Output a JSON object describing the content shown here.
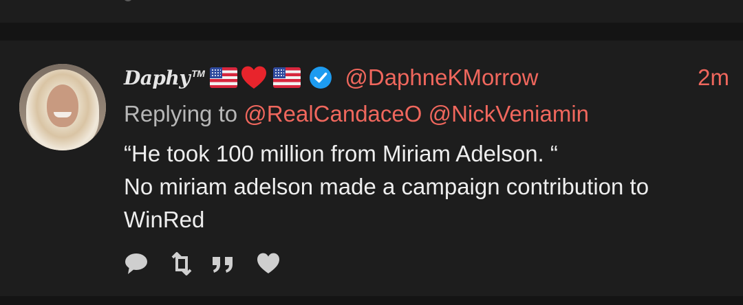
{
  "tweet": {
    "display_name": "Daphy",
    "trademark": "TM",
    "emojis": [
      "us-flag",
      "red-heart",
      "us-flag"
    ],
    "verified_icon": "verified-badge-icon",
    "handle": "@DaphneKMorrow",
    "time": "2m",
    "replying_prefix": "Replying to",
    "replying_to": [
      "@RealCandaceO",
      "@NickVeniamin"
    ],
    "text_lines": [
      "“He took 100 million from Miriam Adelson. “",
      "No miriam adelson made a campaign contribution to",
      "WinRed"
    ]
  },
  "actions": [
    {
      "name": "reply",
      "icon": "reply-bubble-icon"
    },
    {
      "name": "retweet",
      "icon": "retweet-icon"
    },
    {
      "name": "quote",
      "icon": "quote-icon"
    },
    {
      "name": "like",
      "icon": "heart-icon"
    }
  ],
  "colors": {
    "background": "#151515",
    "card": "#1d1d1d",
    "accent": "#f0675d",
    "text": "#eeeeee",
    "muted": "#b7b7b7",
    "verified": "#1d9bf0",
    "icon": "#cfcfcf"
  }
}
